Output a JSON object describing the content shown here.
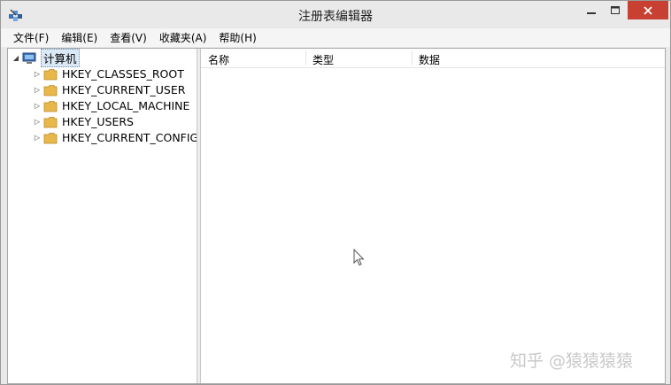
{
  "window": {
    "title": "注册表编辑器"
  },
  "menu": [
    "文件(F)",
    "编辑(E)",
    "查看(V)",
    "收藏夹(A)",
    "帮助(H)"
  ],
  "tree": {
    "root": "计算机",
    "children": [
      "HKEY_CLASSES_ROOT",
      "HKEY_CURRENT_USER",
      "HKEY_LOCAL_MACHINE",
      "HKEY_USERS",
      "HKEY_CURRENT_CONFIG"
    ]
  },
  "list": {
    "columns": [
      "名称",
      "类型",
      "数据"
    ]
  },
  "watermark": "知乎 @猿猿猿猿",
  "colors": {
    "close_button": "#c84031",
    "folder": "#e8b84a",
    "selection": "#dbe9f7"
  }
}
